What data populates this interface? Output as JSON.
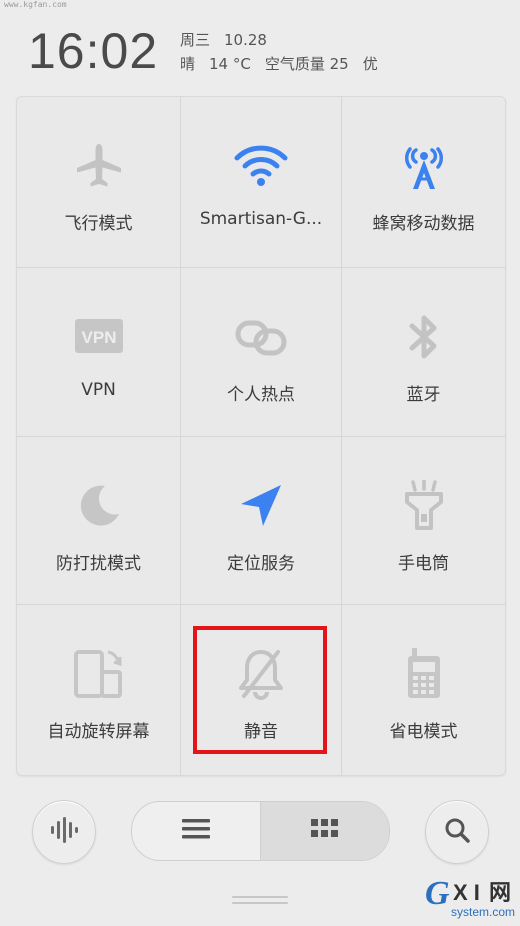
{
  "watermark_top": "www.kgfan.com",
  "header": {
    "time": "16:02",
    "weekday": "周三",
    "date": "10.28",
    "weather": "晴",
    "temperature": "14 °C",
    "air_quality_label": "空气质量 25",
    "air_quality_level": "优"
  },
  "tiles": [
    {
      "label": "飞行模式",
      "icon": "airplane-icon",
      "active": false
    },
    {
      "label": "Smartisan-G...",
      "icon": "wifi-icon",
      "active": true
    },
    {
      "label": "蜂窝移动数据",
      "icon": "cellular-tower-icon",
      "active": true
    },
    {
      "label": "VPN",
      "icon": "vpn-icon",
      "active": false
    },
    {
      "label": "个人热点",
      "icon": "hotspot-icon",
      "active": false
    },
    {
      "label": "蓝牙",
      "icon": "bluetooth-icon",
      "active": false
    },
    {
      "label": "防打扰模式",
      "icon": "moon-icon",
      "active": false
    },
    {
      "label": "定位服务",
      "icon": "location-arrow-icon",
      "active": true
    },
    {
      "label": "手电筒",
      "icon": "flashlight-icon",
      "active": false
    },
    {
      "label": "自动旋转屏幕",
      "icon": "rotate-screen-icon",
      "active": false
    },
    {
      "label": "静音",
      "icon": "bell-off-icon",
      "active": false
    },
    {
      "label": "省电模式",
      "icon": "battery-phone-icon",
      "active": false
    }
  ],
  "bottom": {
    "left_icon": "voice-bars-icon",
    "seg_left_icon": "list-icon",
    "seg_right_icon": "grid-icon",
    "right_icon": "search-icon"
  },
  "watermark_brand": {
    "main": "GXI",
    "suffix": "网",
    "sub": "system.com"
  },
  "colors": {
    "accent_blue": "#3b82f0",
    "inactive_gray": "#c2c2c2",
    "highlight_red": "#e3151b"
  }
}
